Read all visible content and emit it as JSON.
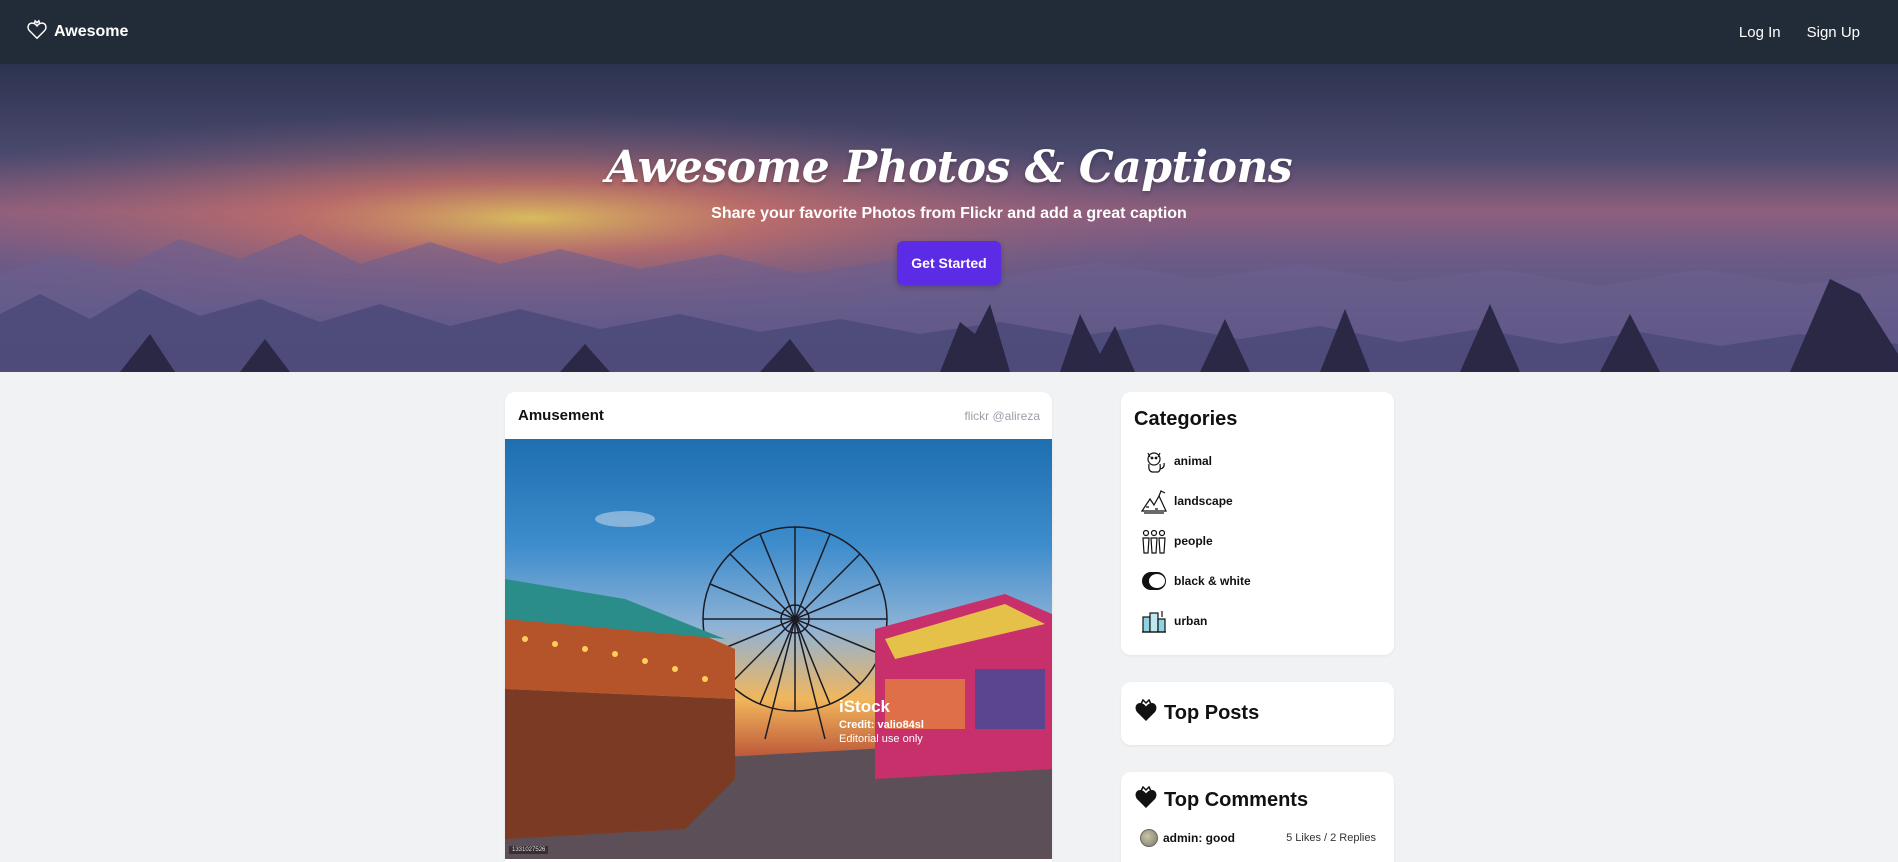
{
  "nav": {
    "brand": "Awesome",
    "login": "Log In",
    "signup": "Sign Up"
  },
  "hero": {
    "title": "Awesome Photos & Captions",
    "subtitle": "Share your favorite Photos from Flickr and add a great caption",
    "cta": "Get Started"
  },
  "post": {
    "title": "Amusement",
    "credit": "flickr @alireza",
    "watermark_title": "iStock",
    "watermark_credit": "Credit: valio84sl",
    "watermark_note": "Editorial use only",
    "image_id": "1331027526"
  },
  "categories": {
    "title": "Categories",
    "items": [
      {
        "label": "animal",
        "icon": "cat-icon"
      },
      {
        "label": "landscape",
        "icon": "mountain-icon"
      },
      {
        "label": "people",
        "icon": "people-icon"
      },
      {
        "label": "black & white",
        "icon": "contrast-icon"
      },
      {
        "label": "urban",
        "icon": "buildings-icon"
      }
    ]
  },
  "top_posts": {
    "title": "Top Posts"
  },
  "top_comments": {
    "title": "Top Comments",
    "items": [
      {
        "text": "admin: good",
        "meta": "5 Likes / 2 Replies"
      }
    ]
  },
  "colors": {
    "navbar": "#222b38",
    "accent": "#5b2be5",
    "page_bg": "#f1f2f4"
  }
}
